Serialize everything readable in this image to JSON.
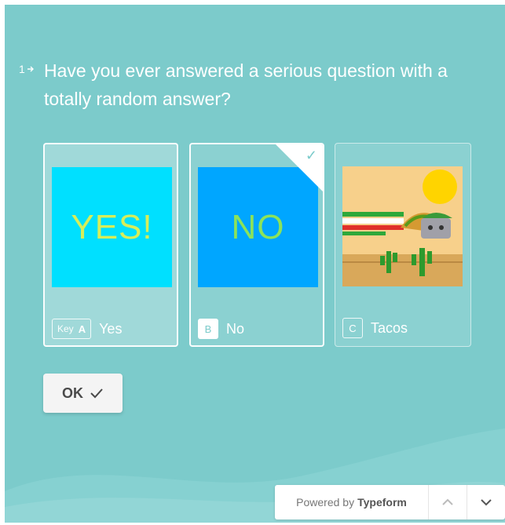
{
  "question": {
    "number": "1",
    "arrow_icon": "arrow-right-icon",
    "text": "Have you ever answered a serious question with a totally random answer?"
  },
  "choices": [
    {
      "key_hint": "Key",
      "key": "A",
      "label": "Yes",
      "image_text": "YES!",
      "selected": false
    },
    {
      "key": "B",
      "label": "No",
      "image_text": "NO",
      "selected": true
    },
    {
      "key": "C",
      "label": "Tacos",
      "image_text": "",
      "selected": false
    }
  ],
  "ok_button": {
    "label": "OK",
    "icon": "check-icon"
  },
  "footer": {
    "powered_prefix": "Powered by",
    "brand": "Typeform",
    "up_icon": "chevron-up-icon",
    "down_icon": "chevron-down-icon"
  },
  "colors": {
    "background": "#7ccbcb",
    "yes_image_bg": "#00e0ff",
    "no_image_bg": "#00a6ff",
    "tacos_image_bg": "#f7d08b"
  }
}
